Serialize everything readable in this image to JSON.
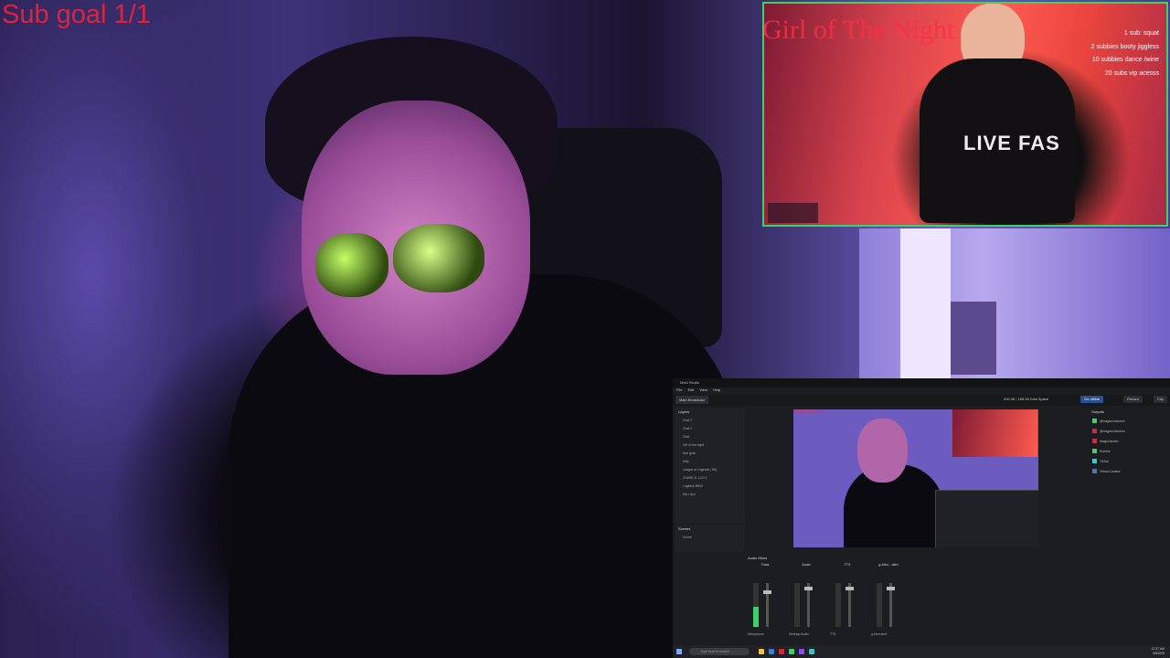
{
  "sub_goal": "Sub goal 1/1",
  "overlay": {
    "title_text": "Girl of The Night",
    "shirt_text": "LIVE FAS",
    "goals": [
      "1 sub: squat",
      "2 subbies booty jiggless",
      "10 subbies dance /wine",
      "20 subs vip acesss"
    ]
  },
  "obs": {
    "app_title": "Meld Studio",
    "menu": [
      "File",
      "Edit",
      "View",
      "Help"
    ],
    "active_tab": "Main Broadcast",
    "stats": "200.36 / 168.90  Disk Space",
    "buttons": {
      "stream": "Go offline",
      "record": "Record",
      "clip": "Clip"
    },
    "layers_title": "Layers",
    "layers": [
      "Chat 2",
      "Chat 2",
      "Chat",
      "Girl of the night",
      "Sub goal",
      "Kitty",
      "League of Legends (TM)",
      "ZOWIE XL LCD 1",
      "Logitech BRIO",
      "Mic / Aux"
    ],
    "scenes_title": "Scenes",
    "scenes": [
      "Scene"
    ],
    "outputs_title": "Outputs",
    "outputs": [
      {
        "label": "@magiccchickenn",
        "color": "#3bd16b"
      },
      {
        "label": "@magiccchickenn",
        "color": "#e0233a"
      },
      {
        "label": "Magicchicken",
        "color": "#e0233a"
      },
      {
        "label": "Rumble",
        "color": "#3bd16b"
      },
      {
        "label": "TikTok",
        "color": "#33c9c9"
      },
      {
        "label": "Virtual Camera",
        "color": "#3b7bd1"
      }
    ],
    "mixer_title": "Audio Mixer",
    "channels": [
      {
        "name": "Track",
        "device": "Microphone",
        "level": 0.45
      },
      {
        "name": "Audio",
        "device": "Desktop Audio",
        "level": 0.0
      },
      {
        "name": "TTS",
        "device": "TTS",
        "level": 0.0
      },
      {
        "name": "g-Med... alert",
        "device": "g-Med alert",
        "level": 0.0
      }
    ],
    "taskbar": {
      "search": "Type here to search",
      "time": "12:37 AM",
      "date": "3/8/2025"
    }
  },
  "colors": {
    "sub_goal": "#e0233a",
    "overlay_border": "#3bd16b",
    "obs_bg": "#1c1d20"
  }
}
